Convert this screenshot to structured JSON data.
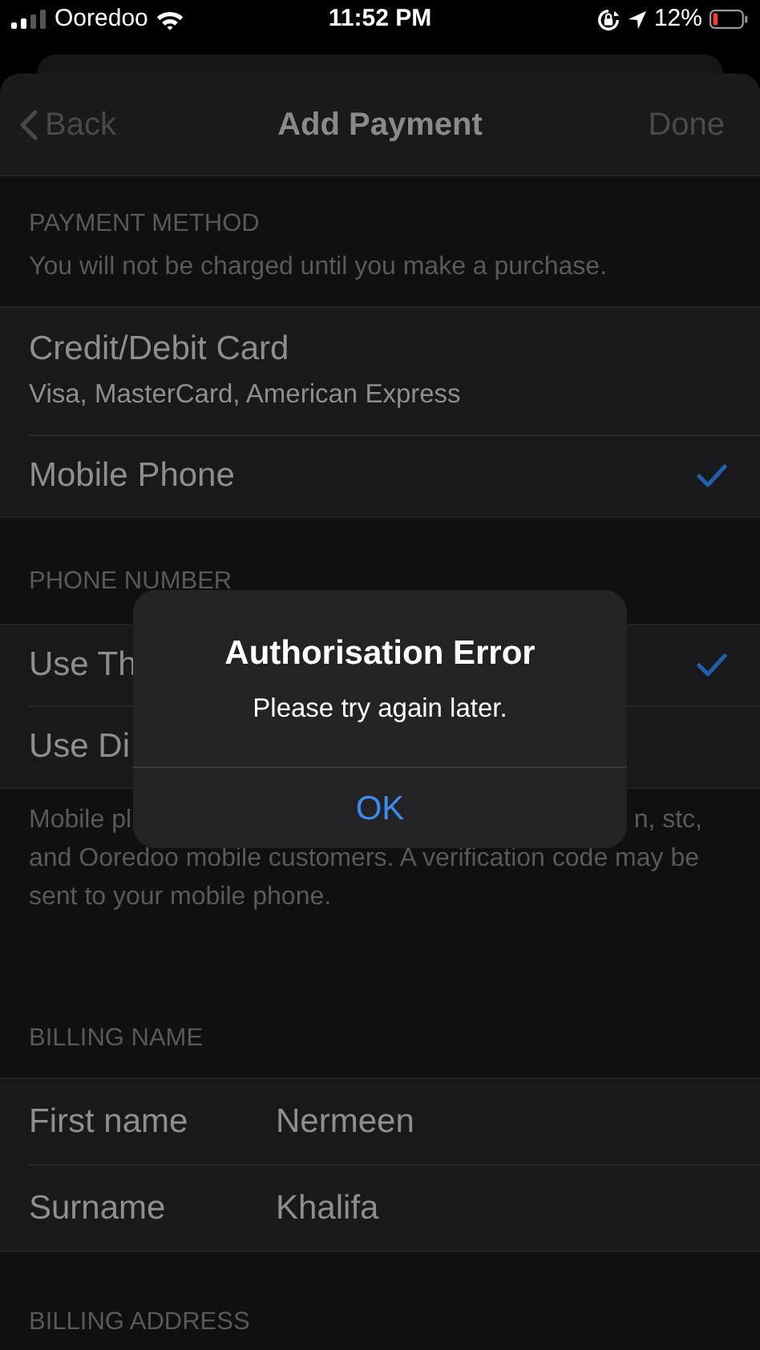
{
  "status_bar": {
    "carrier": "Ooredoo",
    "time": "11:52 PM",
    "battery": "12%"
  },
  "nav": {
    "back": "Back",
    "title": "Add Payment",
    "done": {
      "label": "Done",
      "disabled": true
    }
  },
  "payment_method": {
    "header": "PAYMENT METHOD",
    "note": "You will not be charged until you make a purchase.",
    "options": [
      {
        "title": "Credit/Debit Card",
        "subtitle": "Visa, MasterCard, American Express",
        "selected": false
      },
      {
        "title": "Mobile Phone",
        "selected": true
      }
    ]
  },
  "phone_number": {
    "header": "PHONE NUMBER",
    "options": [
      {
        "title": "Use Th",
        "selected": true
      },
      {
        "title": "Use Di",
        "selected": false
      }
    ],
    "footer_lines": [
      [
        "Mobile pl",
        "n, stc,"
      ],
      [
        "and Ooredoo mobile customers. A verification code may be"
      ],
      [
        "sent to your mobile phone."
      ]
    ]
  },
  "billing_name": {
    "header": "BILLING NAME",
    "fields": [
      {
        "label": "First name",
        "value": "Nermeen"
      },
      {
        "label": "Surname",
        "value": "Khalifa"
      }
    ]
  },
  "billing_address": {
    "header": "BILLING ADDRESS"
  },
  "alert": {
    "title": "Authorisation Error",
    "message": "Please try again later.",
    "button": "OK"
  }
}
